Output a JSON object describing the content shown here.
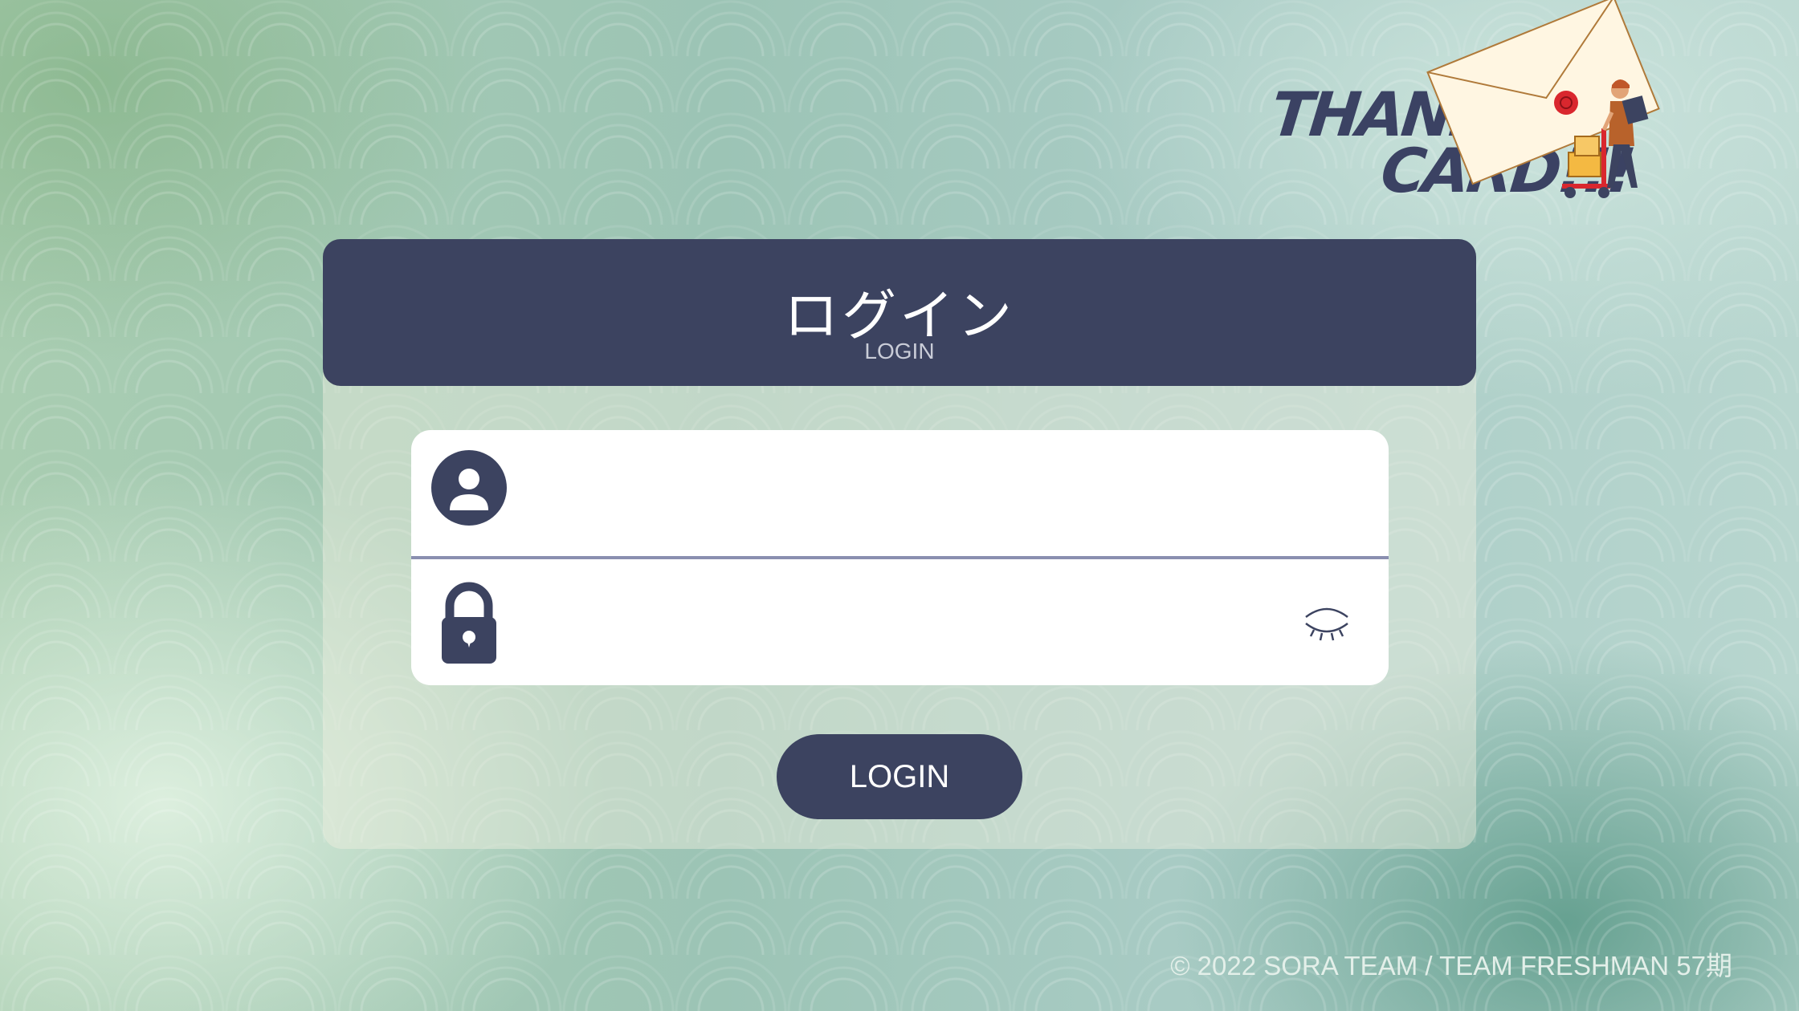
{
  "logo": {
    "line1": "THANK",
    "line2": "CARD!!!"
  },
  "login_panel": {
    "title": "ログイン",
    "subtitle": "LOGIN",
    "username_field": {
      "value": "",
      "placeholder": "",
      "icon": "user-circle-icon"
    },
    "password_field": {
      "value": "",
      "placeholder": "",
      "icon": "padlock-icon",
      "toggle_icon": "eye-closed-icon"
    },
    "submit_label": "LOGIN"
  },
  "footer": {
    "copyright": "© 2022 SORA TEAM / TEAM FRESHMAN 57期"
  },
  "colors": {
    "primary": "#3c4360",
    "divider": "#8a8fb0",
    "wax_seal": "#d9272e",
    "envelope": "#fff6e2"
  }
}
